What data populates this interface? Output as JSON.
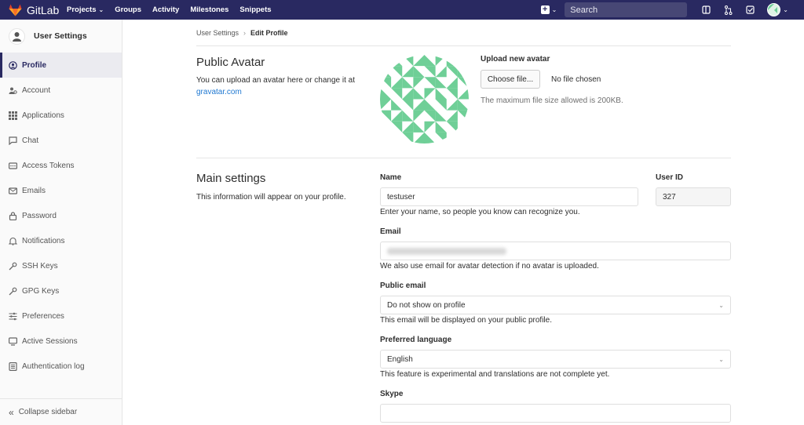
{
  "app": {
    "name": "GitLab"
  },
  "nav": {
    "links": [
      "Projects",
      "Groups",
      "Activity",
      "Milestones",
      "Snippets"
    ],
    "search_placeholder": "Search"
  },
  "sidebar": {
    "title": "User Settings",
    "items": [
      {
        "label": "Profile",
        "icon": "profile-icon",
        "active": true
      },
      {
        "label": "Account",
        "icon": "account-icon"
      },
      {
        "label": "Applications",
        "icon": "applications-icon"
      },
      {
        "label": "Chat",
        "icon": "chat-icon"
      },
      {
        "label": "Access Tokens",
        "icon": "token-icon"
      },
      {
        "label": "Emails",
        "icon": "envelope-icon"
      },
      {
        "label": "Password",
        "icon": "lock-icon"
      },
      {
        "label": "Notifications",
        "icon": "bell-icon"
      },
      {
        "label": "SSH Keys",
        "icon": "key-icon"
      },
      {
        "label": "GPG Keys",
        "icon": "key-icon"
      },
      {
        "label": "Preferences",
        "icon": "sliders-icon"
      },
      {
        "label": "Active Sessions",
        "icon": "monitor-icon"
      },
      {
        "label": "Authentication log",
        "icon": "log-icon"
      }
    ],
    "collapse_label": "Collapse sidebar"
  },
  "breadcrumb": {
    "parent": "User Settings",
    "current": "Edit Profile"
  },
  "avatar_section": {
    "title": "Public Avatar",
    "desc": "You can upload an avatar here or change it at",
    "link": "gravatar.com",
    "upload_label": "Upload new avatar",
    "choose_button": "Choose file...",
    "no_file": "No file chosen",
    "max_size_help": "The maximum file size allowed is 200KB."
  },
  "main_settings": {
    "title": "Main settings",
    "desc": "This information will appear on your profile.",
    "name_label": "Name",
    "name_value": "testuser",
    "name_help": "Enter your name, so people you know can recognize you.",
    "userid_label": "User ID",
    "userid_value": "327",
    "email_label": "Email",
    "email_help": "We also use email for avatar detection if no avatar is uploaded.",
    "public_email_label": "Public email",
    "public_email_value": "Do not show on profile",
    "public_email_help": "This email will be displayed on your public profile.",
    "language_label": "Preferred language",
    "language_value": "English",
    "language_help": "This feature is experimental and translations are not complete yet.",
    "skype_label": "Skype",
    "skype_value": ""
  },
  "colors": {
    "navbar": "#292961",
    "avatar_green": "#6fcf97",
    "link": "#1f78d1"
  }
}
